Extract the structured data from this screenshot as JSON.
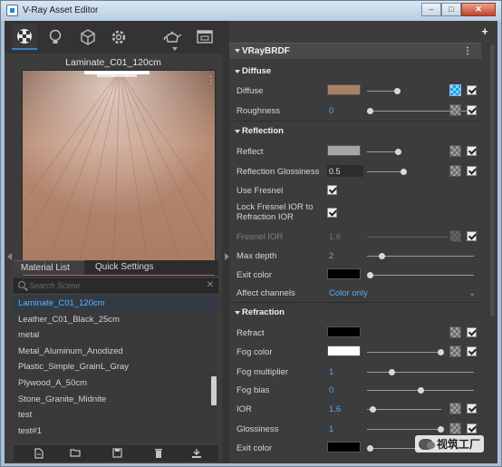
{
  "window": {
    "title": "V-Ray Asset Editor",
    "controls": [
      "–",
      "□",
      "✕"
    ]
  },
  "left": {
    "toolbar": {
      "icons": [
        "materials-icon",
        "lights-icon",
        "geometry-icon",
        "settings-icon",
        "teapot-icon",
        "render-output-icon"
      ]
    },
    "preview_title": "Laminate_C01_120cm",
    "tabs": [
      "Material List",
      "Quick Settings"
    ],
    "search": {
      "placeholder": "Search Scene"
    },
    "materials": [
      "Laminate_C01_120cm",
      "Leather_C01_Black_25cm",
      "metal",
      "Metal_Aluminum_Anodized",
      "Plastic_Simple_GrainL_Gray",
      "Plywood_A_50cm",
      "Stone_Granite_Midnite",
      "test",
      "test#1"
    ],
    "selected_index": 0,
    "bottom_tools": [
      "new-file-icon",
      "open-folder-icon",
      "save-icon",
      "delete-icon",
      "import-icon"
    ]
  },
  "right": {
    "header": "VRayBRDF",
    "sections": {
      "diffuse": "Diffuse",
      "reflection": "Reflection",
      "refraction": "Refraction"
    },
    "rows": {
      "diffuse": {
        "label": "Diffuse",
        "color": "#a98163"
      },
      "roughness": {
        "label": "Roughness",
        "value": "0"
      },
      "reflect": {
        "label": "Reflect",
        "color": "#a6a6a6"
      },
      "refl_gloss": {
        "label": "Reflection Glossiness",
        "value": "0.5"
      },
      "use_fresnel": {
        "label": "Use Fresnel"
      },
      "lock_fresnel": {
        "label_line1": "Lock Fresnel IOR to",
        "label_line2": "Refraction IOR"
      },
      "fresnel_ior": {
        "label": "Fresnel IOR",
        "value": "1.6"
      },
      "max_depth": {
        "label": "Max depth",
        "value": "2"
      },
      "exit_color_refl": {
        "label": "Exit color",
        "color": "#000000"
      },
      "affect_channels": {
        "label": "Affect channels",
        "value": "Color only"
      },
      "refract": {
        "label": "Refract",
        "color": "#000000"
      },
      "fog_color": {
        "label": "Fog color",
        "color": "#ffffff"
      },
      "fog_multiplier": {
        "label": "Fog multiplier",
        "value": "1"
      },
      "fog_bias": {
        "label": "Fog bias",
        "value": "0"
      },
      "ior": {
        "label": "IOR",
        "value": "1.6"
      },
      "glossiness": {
        "label": "Glossiness",
        "value": "1"
      },
      "exit_color_refr": {
        "label": "Exit color",
        "color": "#000000"
      }
    }
  },
  "watermark": "视筑工厂"
}
